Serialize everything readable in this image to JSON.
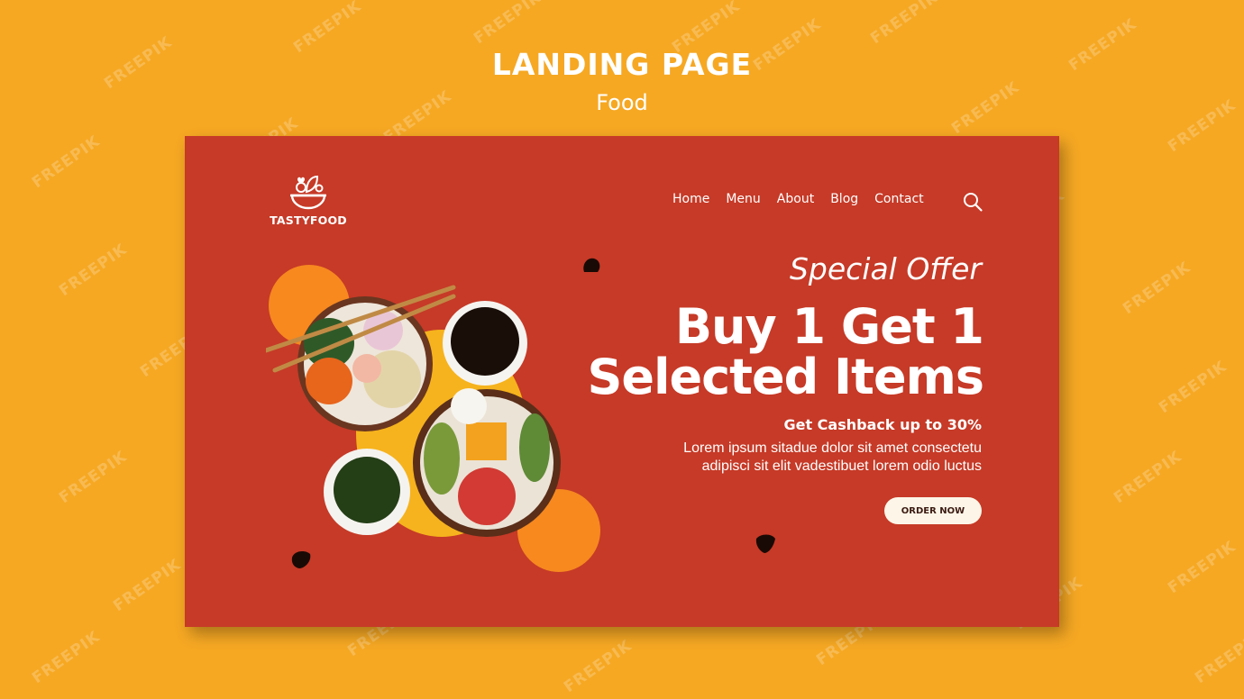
{
  "header": {
    "title": "LANDING PAGE",
    "subtitle": "Food"
  },
  "logo": {
    "name": "TASTYFOOD",
    "icon": "salad-bowl-icon"
  },
  "nav": {
    "items": [
      "Home",
      "Menu",
      "About",
      "Blog",
      "Contact"
    ],
    "search_icon": "search-icon"
  },
  "hero": {
    "offer": "Special Offer",
    "headline_line1": "Buy 1 Get 1",
    "headline_line2": "Selected Items",
    "cashback": "Get Cashback up to 30%",
    "desc_line1": "Lorem ipsum sitadue dolor sit amet consectetu",
    "desc_line2": "adipisci sit elit vadestibuet lorem odio luctus",
    "cta": "ORDER NOW"
  },
  "watermark": {
    "text": "FREEPIK"
  },
  "colors": {
    "page_bg": "#f6a823",
    "card_bg": "#c63a27",
    "accent_orange": "#f7891f",
    "accent_yellow": "#f6b31d",
    "button_bg": "#fdf6e8"
  }
}
